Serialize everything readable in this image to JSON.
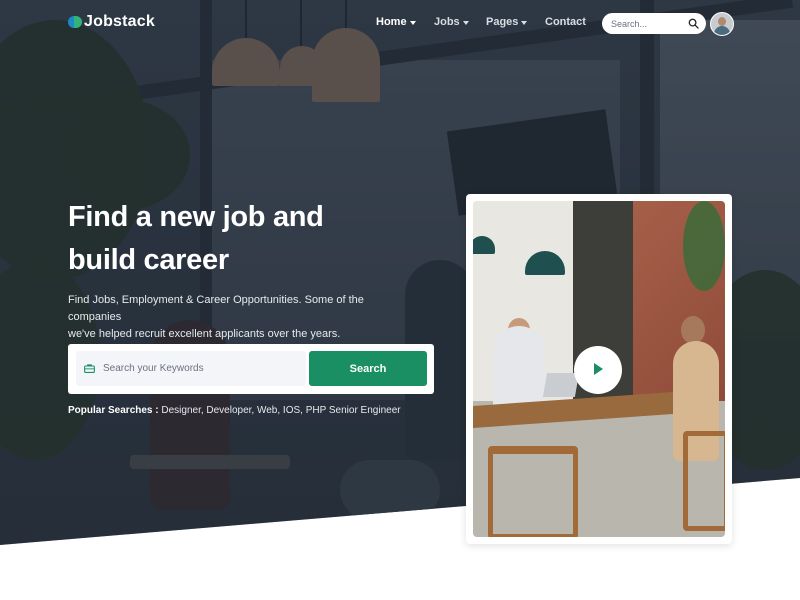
{
  "brand": {
    "name": "Jobstack"
  },
  "nav": {
    "items": [
      {
        "label": "Home",
        "has_dropdown": true,
        "active": true
      },
      {
        "label": "Jobs",
        "has_dropdown": true,
        "active": false
      },
      {
        "label": "Pages",
        "has_dropdown": true,
        "active": false
      },
      {
        "label": "Contact",
        "has_dropdown": false,
        "active": false
      }
    ],
    "search_placeholder": "Search...",
    "search_icon": "search-icon",
    "avatar_icon": "user-avatar"
  },
  "hero": {
    "headline_line1": "Find a new job and",
    "headline_line2": "build career",
    "subtitle_line1": "Find Jobs, Employment & Career Opportunities. Some of the companies",
    "subtitle_line2": "we've helped recruit excellent applicants over the years.",
    "keyword_placeholder": "Search your Keywords",
    "keyword_icon": "briefcase-icon",
    "search_button": "Search",
    "popular_label": "Popular Searches :",
    "popular_terms": "Designer, Developer, Web, IOS, PHP Senior Engineer"
  },
  "video": {
    "play_icon": "play-icon"
  },
  "colors": {
    "accent": "#1a8f63",
    "logo_blue": "#1e88c9",
    "logo_green": "#30b47a",
    "white": "#ffffff"
  }
}
